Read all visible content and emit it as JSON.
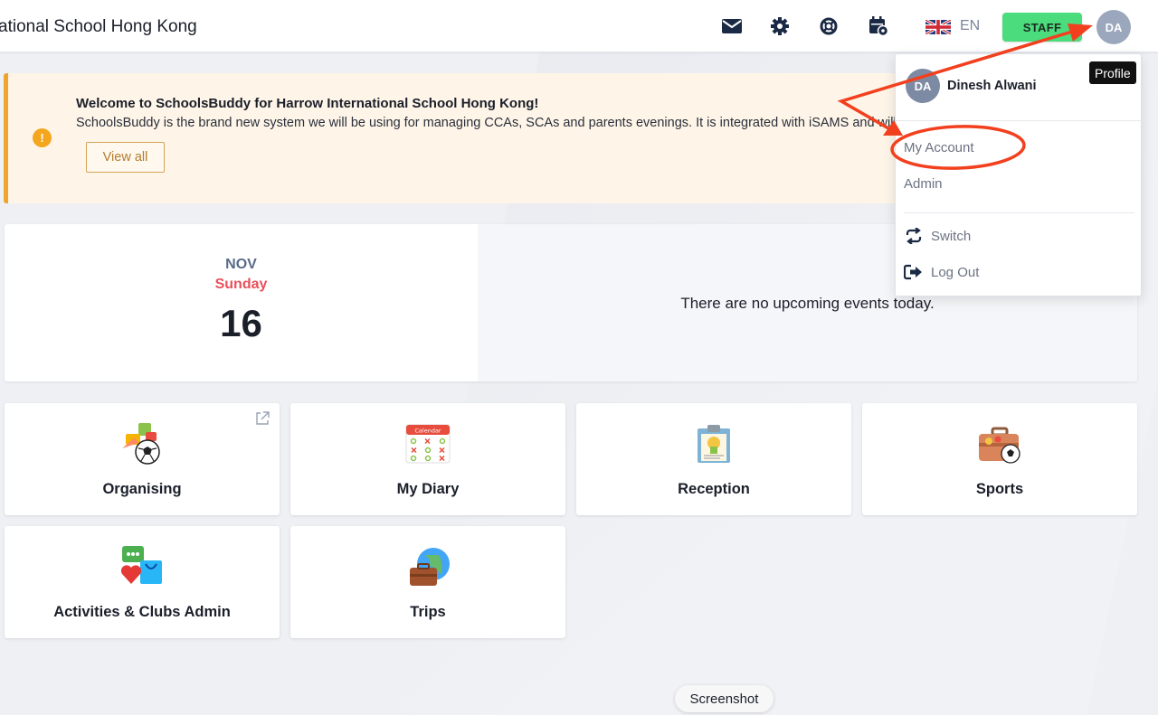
{
  "header": {
    "school_title": "ational School Hong Kong",
    "language": "EN",
    "role_button": "STAFF",
    "avatar_initials": "DA"
  },
  "banner": {
    "title": "Welcome to SchoolsBuddy for Harrow International School Hong Kong!",
    "text": "SchoolsBuddy is the brand new system we will be using for managing CCAs, SCAs and parents evenings. It is integrated with iSAMS and will",
    "button": "View all",
    "icon": "!"
  },
  "date_card": {
    "month": "NOV",
    "weekday": "Sunday",
    "day": "16",
    "no_events": "There are no upcoming events today."
  },
  "tiles": [
    {
      "label": "Organising",
      "icon": "organising-icon"
    },
    {
      "label": "My Diary",
      "icon": "calendar-icon"
    },
    {
      "label": "Reception",
      "icon": "reception-icon"
    },
    {
      "label": "Sports",
      "icon": "sports-icon"
    },
    {
      "label": "Activities & Clubs Admin",
      "icon": "activities-icon"
    },
    {
      "label": "Trips",
      "icon": "trips-icon"
    }
  ],
  "dropdown": {
    "avatar_initials": "DA",
    "name": "Dinesh Alwani",
    "tooltip": "Profile",
    "items": [
      "My Account",
      "Admin"
    ],
    "actions": [
      {
        "label": "Switch",
        "icon": "switch-icon"
      },
      {
        "label": "Log Out",
        "icon": "logout-icon"
      }
    ]
  },
  "screenshot_pill": "Screenshot",
  "colors": {
    "staff_green": "#4bdc7e",
    "banner_bg": "#fef5e8",
    "banner_border": "#f0a42b",
    "weekday_red": "#e8505b",
    "annotation_red": "#f2401f"
  }
}
